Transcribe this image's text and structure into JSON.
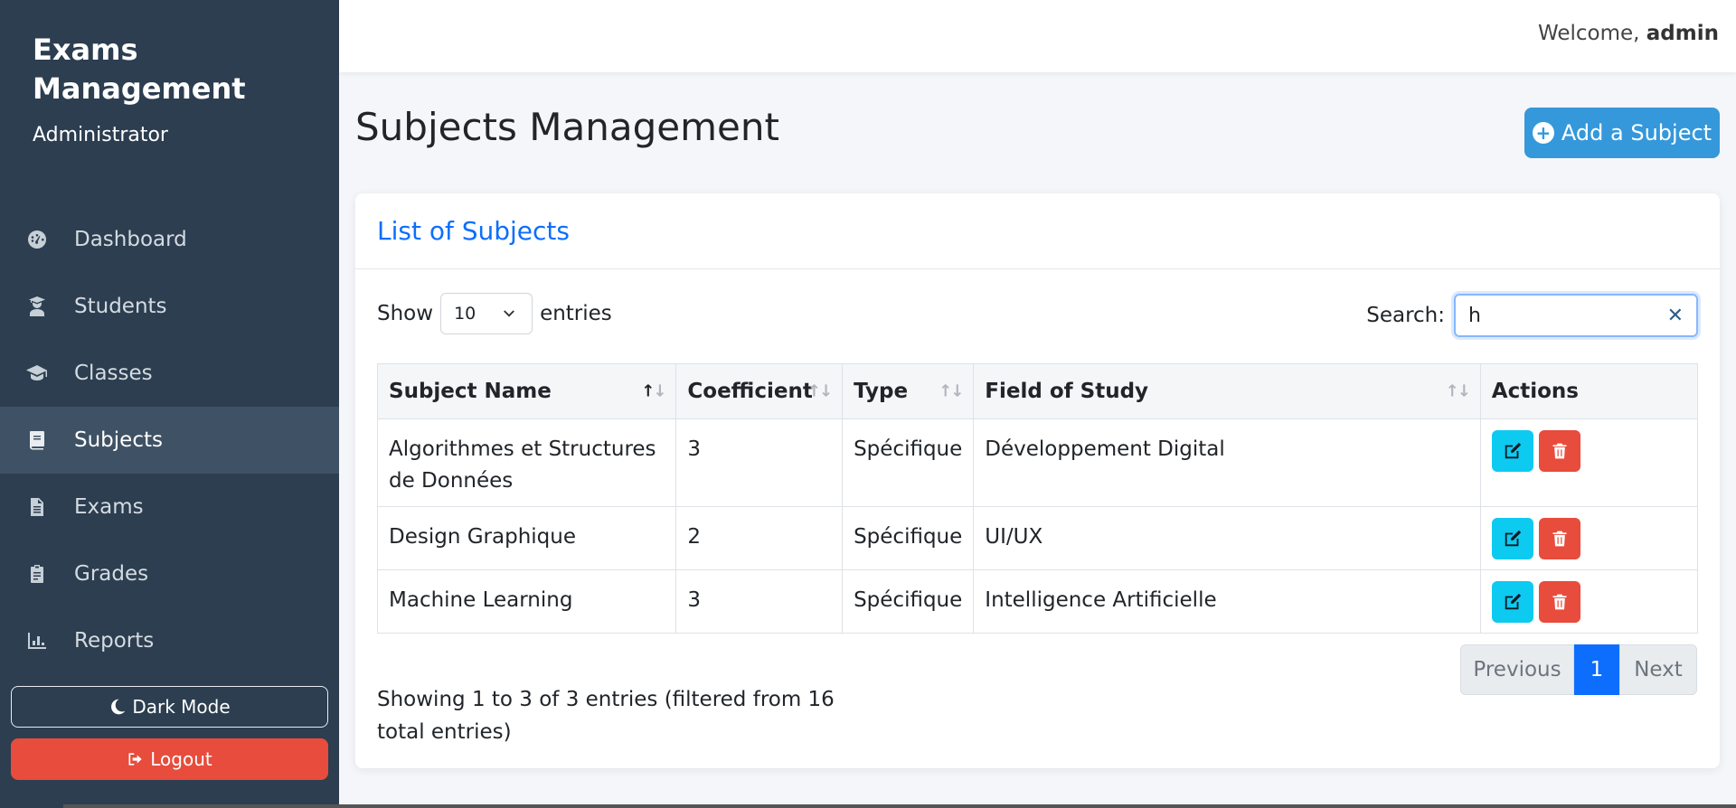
{
  "sidebar": {
    "title": "Exams Management",
    "role": "Administrator",
    "items": [
      {
        "label": "Dashboard",
        "icon": "gauge-icon"
      },
      {
        "label": "Students",
        "icon": "user-graduate-icon"
      },
      {
        "label": "Classes",
        "icon": "graduation-cap-icon"
      },
      {
        "label": "Subjects",
        "icon": "book-icon",
        "active": true
      },
      {
        "label": "Exams",
        "icon": "file-alt-icon"
      },
      {
        "label": "Grades",
        "icon": "clipboard-check-icon"
      },
      {
        "label": "Reports",
        "icon": "chart-bar-icon"
      }
    ],
    "dark_mode_label": "Dark Mode",
    "logout_label": "Logout"
  },
  "topbar": {
    "welcome_prefix": "Welcome,",
    "username": "admin"
  },
  "page": {
    "title": "Subjects Management",
    "add_button_label": "Add a Subject"
  },
  "card": {
    "title": "List of Subjects",
    "show_label": "Show",
    "entries_label": "entries",
    "page_length": "10",
    "search_label": "Search:",
    "search_value": "h",
    "columns": [
      "Subject Name",
      "Coefficient",
      "Type",
      "Field of Study",
      "Actions"
    ],
    "rows": [
      {
        "name": "Algorithmes et Structures de Données",
        "coefficient": "3",
        "type": "Spécifique",
        "field": "Développement Digital"
      },
      {
        "name": "Design Graphique",
        "coefficient": "2",
        "type": "Spécifique",
        "field": "UI/UX"
      },
      {
        "name": "Machine Learning",
        "coefficient": "3",
        "type": "Spécifique",
        "field": "Intelligence Artificielle"
      }
    ],
    "info": "Showing 1 to 3 of 3 entries (filtered from 16 total entries)",
    "pagination": {
      "previous": "Previous",
      "current": "1",
      "next": "Next"
    }
  },
  "colors": {
    "sidebar_bg": "#2c3e50",
    "primary": "#3498db",
    "danger": "#e74c3c",
    "info": "#0dcaf0",
    "link": "#0d6efd"
  }
}
